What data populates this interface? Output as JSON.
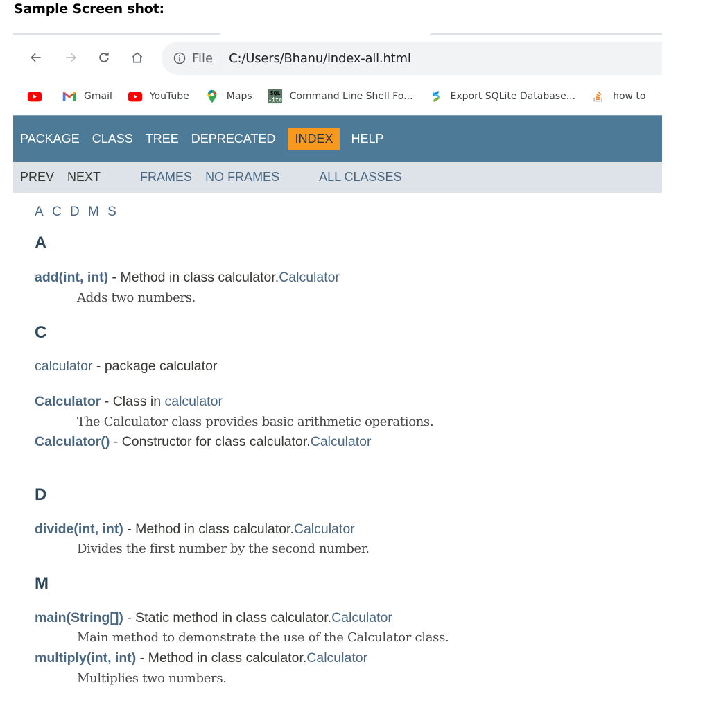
{
  "caption": "Sample Screen shot:",
  "browser": {
    "nav_icons": [
      "back-arrow-icon",
      "forward-arrow-icon",
      "reload-icon",
      "home-icon"
    ],
    "omnibox": {
      "scheme_label": "File",
      "url": "C:/Users/Bhanu/index-all.html"
    },
    "bookmarks": [
      {
        "icon": "youtube-icon",
        "label": ""
      },
      {
        "icon": "gmail-icon",
        "label": "Gmail"
      },
      {
        "icon": "youtube-icon",
        "label": "YouTube"
      },
      {
        "icon": "maps-icon",
        "label": "Maps"
      },
      {
        "icon": "sqlite-icon",
        "label": "Command Line Shell Fo..."
      },
      {
        "icon": "sqlite-export-icon",
        "label": "Export SQLite Database..."
      },
      {
        "icon": "stackoverflow-icon",
        "label": "how to"
      }
    ]
  },
  "colors": {
    "topnav_bg": "#4d7a97",
    "active_tab_bg": "#f8981d",
    "subnav_bg": "#dee3e9",
    "link": "#4a6782",
    "heading": "#2c4557"
  },
  "topnav": {
    "items": [
      "PACKAGE",
      "CLASS",
      "TREE",
      "DEPRECATED",
      "INDEX",
      "HELP"
    ],
    "active": "INDEX"
  },
  "subnav": {
    "prev": "PREV",
    "next": "NEXT",
    "frames": "FRAMES",
    "no_frames": "NO FRAMES",
    "all_classes": "ALL CLASSES"
  },
  "index": {
    "letters": [
      "A",
      "C",
      "D",
      "M",
      "S"
    ],
    "sections": {
      "A": {
        "letter": "A",
        "entries": [
          {
            "name": "add(int, int)",
            "sep": " - ",
            "kind": "Method in class calculator.",
            "link": "Calculator",
            "desc": "Adds two numbers."
          }
        ]
      },
      "C": {
        "letter": "C",
        "entries": [
          {
            "name": "calculator",
            "sep": " - ",
            "kind": "package calculator"
          },
          {
            "name": "Calculator",
            "sep": " - ",
            "kind": "Class in ",
            "link": "calculator",
            "desc": "The Calculator class provides basic arithmetic operations."
          },
          {
            "name": "Calculator()",
            "sep": " - ",
            "kind": "Constructor for class calculator.",
            "link": "Calculator"
          }
        ]
      },
      "D": {
        "letter": "D",
        "entries": [
          {
            "name": "divide(int, int)",
            "sep": " - ",
            "kind": "Method in class calculator.",
            "link": "Calculator",
            "desc": "Divides the first number by the second number."
          }
        ]
      },
      "M": {
        "letter": "M",
        "entries": [
          {
            "name": "main(String[])",
            "sep": " - ",
            "kind": "Static method in class calculator.",
            "link": "Calculator",
            "desc": "Main method to demonstrate the use of the Calculator class."
          },
          {
            "name": "multiply(int, int)",
            "sep": " - ",
            "kind": "Method in class calculator.",
            "link": "Calculator",
            "desc": "Multiplies two numbers."
          }
        ]
      }
    }
  }
}
